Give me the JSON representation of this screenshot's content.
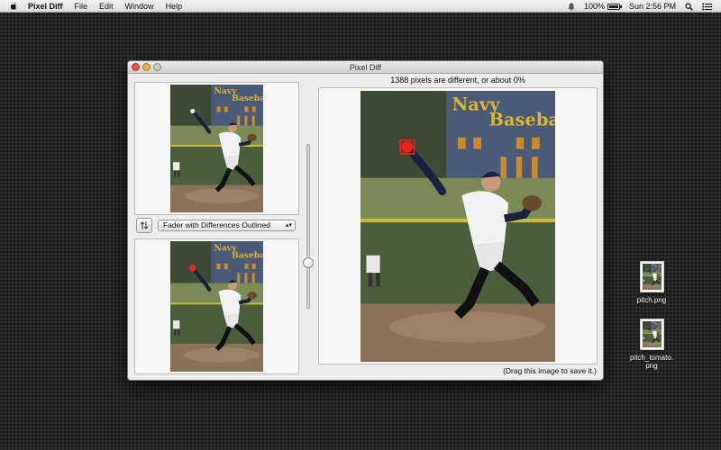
{
  "menubar": {
    "app_name": "Pixel Diff",
    "items": [
      "File",
      "Edit",
      "Window",
      "Help"
    ],
    "battery_percent": "100%",
    "battery_level": 1.0,
    "clock": "Sun 2:56 PM",
    "icons": [
      "apple-icon",
      "notification-icon",
      "battery-icon",
      "spotlight-search-icon",
      "notification-center-icon"
    ]
  },
  "window": {
    "title": "Pixel Diff",
    "diff_summary": "1388 pixels are different, or about 0%",
    "mode_select": "Fader with Differences Outlined",
    "drag_hint": "(Drag this image to save it.)",
    "fader_position": 0.72
  },
  "desktop": {
    "files": [
      {
        "label": "pitch.png"
      },
      {
        "label": "pitch_tomato.\npng"
      }
    ]
  },
  "colors": {
    "close": "#f0524e",
    "minimize": "#e7b23f",
    "highlight_red": "#e8231c"
  }
}
